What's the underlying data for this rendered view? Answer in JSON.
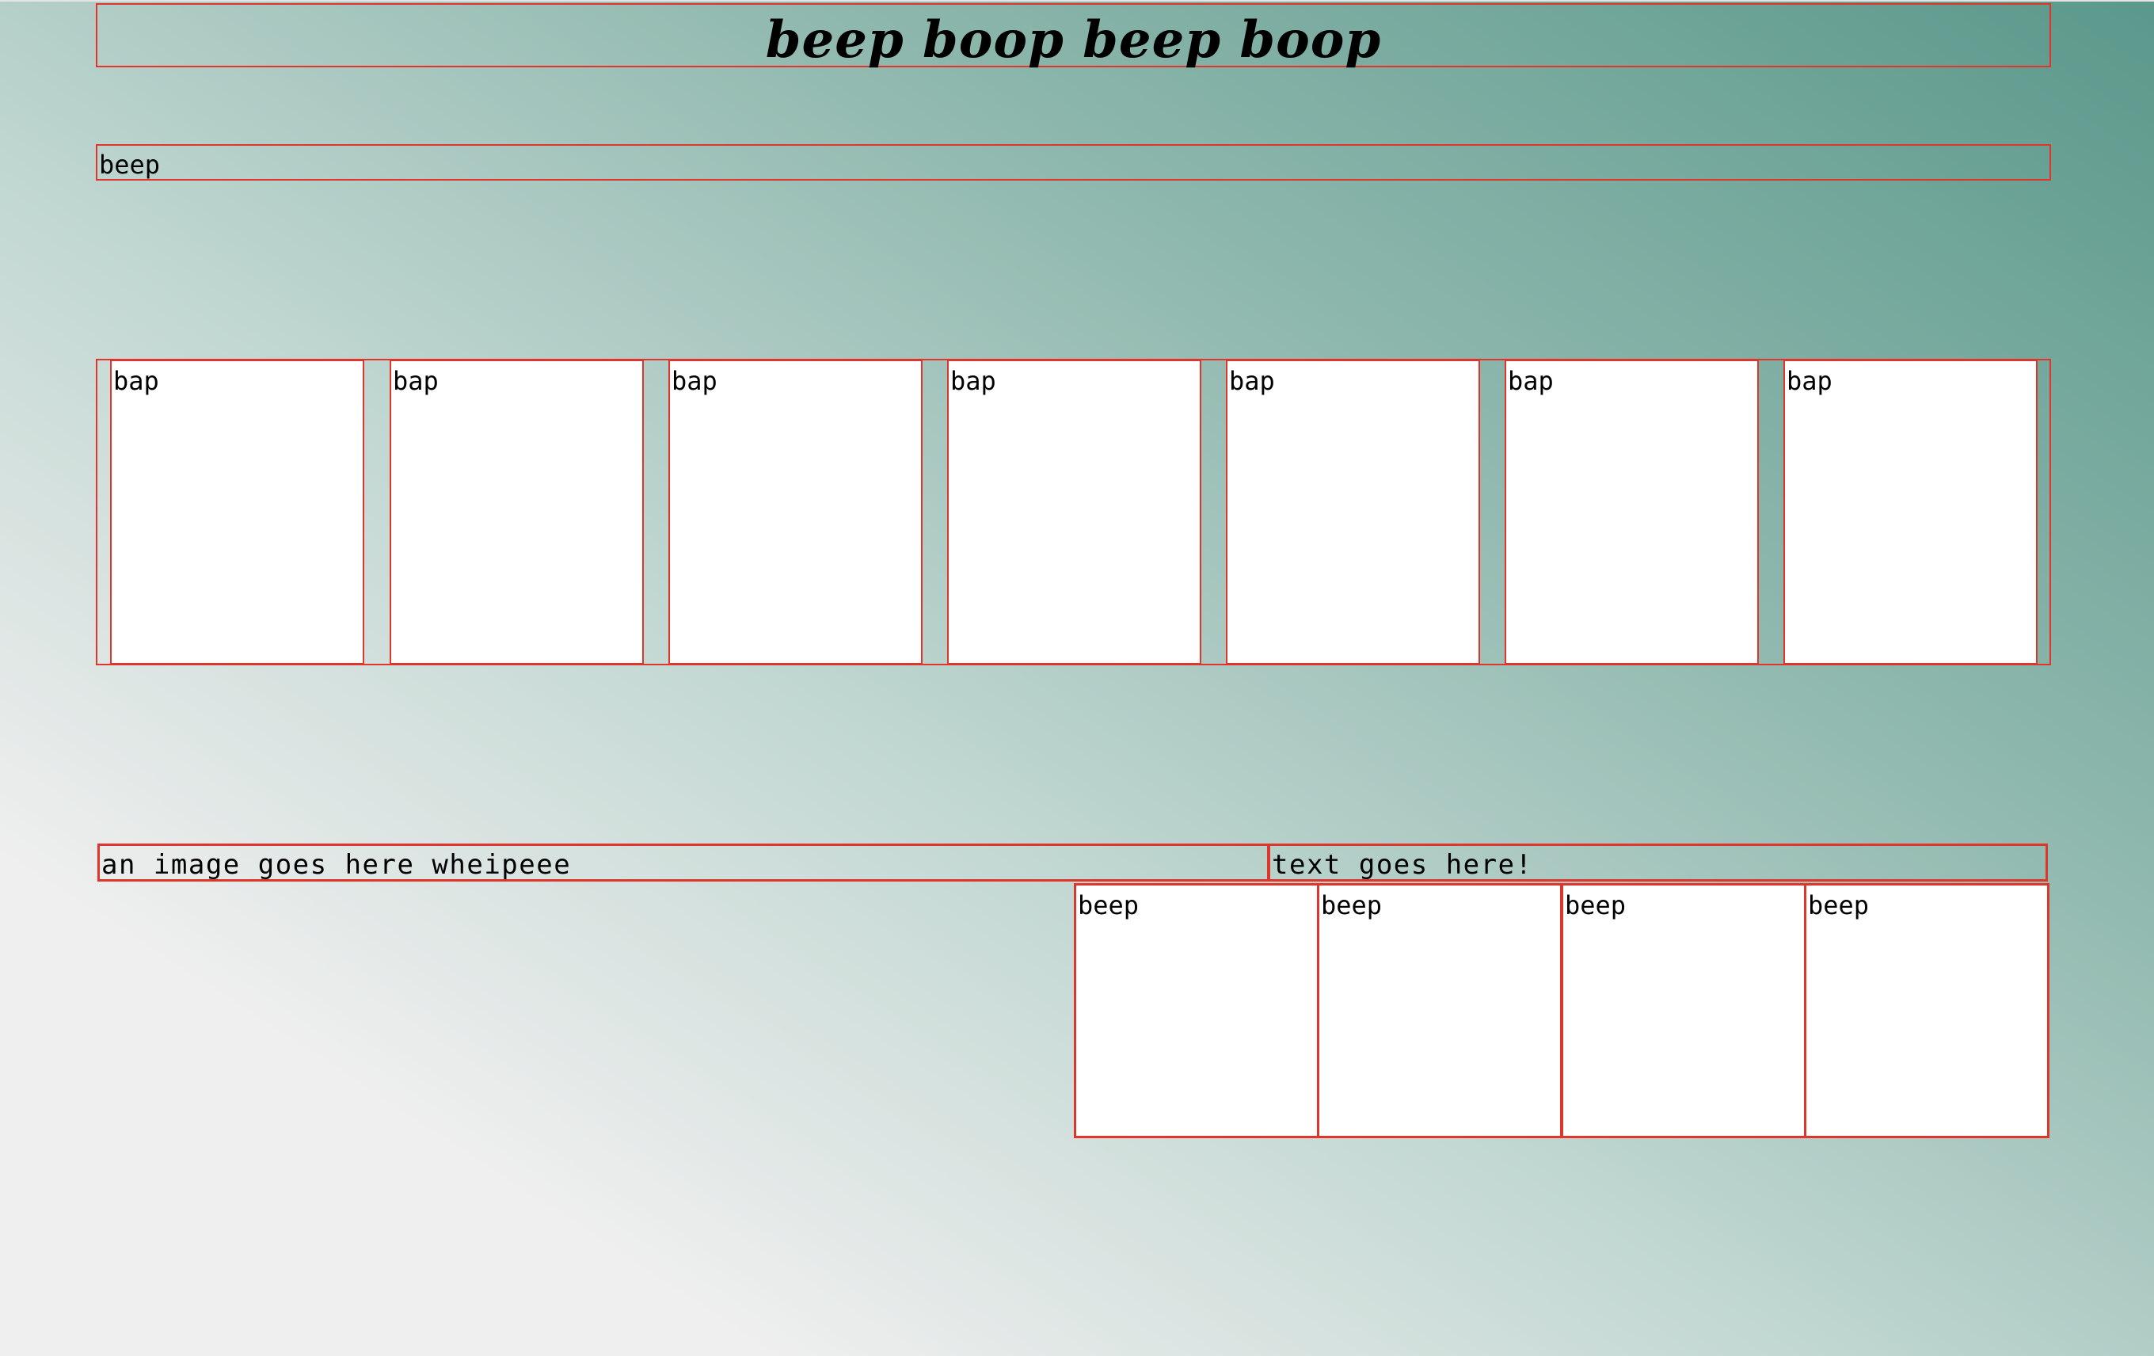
{
  "header": {
    "title": "beep boop beep boop",
    "subtitle": "beep"
  },
  "gallery": {
    "tiles": [
      {
        "label": "bap"
      },
      {
        "label": "bap"
      },
      {
        "label": "bap"
      },
      {
        "label": "bap"
      },
      {
        "label": "bap"
      },
      {
        "label": "bap"
      },
      {
        "label": "bap"
      }
    ]
  },
  "feature": {
    "image_placeholder": "an image goes here wheipeee",
    "text_placeholder": "text goes here!",
    "cards": [
      {
        "label": "beep"
      },
      {
        "label": "beep"
      },
      {
        "label": "beep"
      },
      {
        "label": "beep"
      }
    ]
  },
  "colors": {
    "border": "#e0352b",
    "gradient_start": "#efefef",
    "gradient_end": "#5b988b",
    "tile_background": "#ffffff"
  }
}
